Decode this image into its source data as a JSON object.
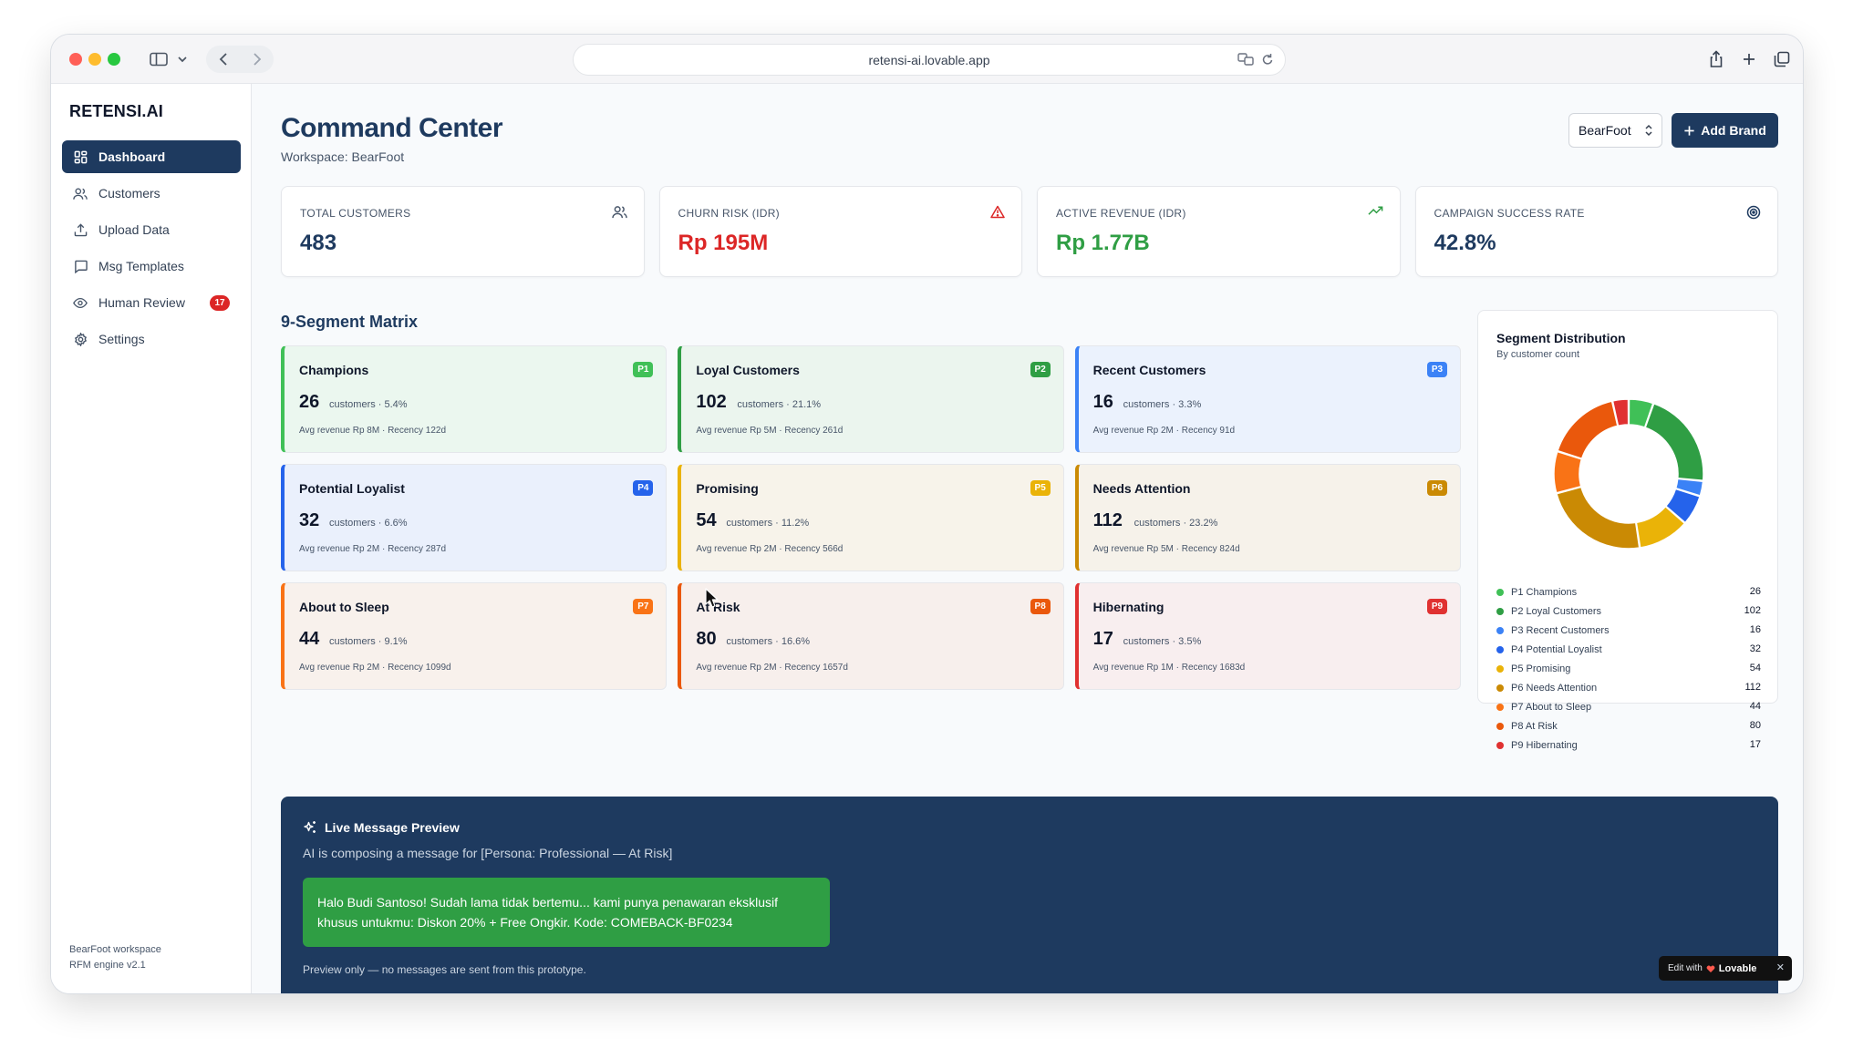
{
  "browser": {
    "url": "retensi-ai.lovable.app"
  },
  "sidebar": {
    "brand": "RETENSI.AI",
    "items": [
      {
        "label": "Dashboard",
        "icon": "grid-icon",
        "active": true
      },
      {
        "label": "Customers",
        "icon": "users-icon"
      },
      {
        "label": "Upload Data",
        "icon": "upload-icon"
      },
      {
        "label": "Msg Templates",
        "icon": "message-icon"
      },
      {
        "label": "Human Review",
        "icon": "eye-icon",
        "badge": "17"
      },
      {
        "label": "Settings",
        "icon": "gear-icon"
      }
    ],
    "footer_line1": "BearFoot workspace",
    "footer_line2": "RFM engine v2.1"
  },
  "header": {
    "title": "Command Center",
    "workspace": "Workspace: BearFoot",
    "brand_select": "BearFoot",
    "add_brand": "Add Brand"
  },
  "kpis": [
    {
      "label": "TOTAL CUSTOMERS",
      "value": "483",
      "icon": "users-icon",
      "color": "#1e3a5f"
    },
    {
      "label": "CHURN RISK (IDR)",
      "value": "Rp 195M",
      "icon": "alert-triangle-icon",
      "color": "#dc2626"
    },
    {
      "label": "ACTIVE REVENUE (IDR)",
      "value": "Rp 1.77B",
      "icon": "trending-up-icon",
      "color": "#2f9e44"
    },
    {
      "label": "CAMPAIGN SUCCESS RATE",
      "value": "42.8%",
      "icon": "target-icon",
      "color": "#1e3a5f"
    }
  ],
  "matrix": {
    "title": "9-Segment Matrix",
    "segments": [
      {
        "name": "Champions",
        "code": "P1",
        "count": "26",
        "sub": "customers · 5.4%",
        "avg": "Avg revenue Rp 8M · Recency 122d",
        "color": "#40c057",
        "bg": "#ebf7ef"
      },
      {
        "name": "Loyal Customers",
        "code": "P2",
        "count": "102",
        "sub": "customers · 21.1%",
        "avg": "Avg revenue Rp 5M · Recency 261d",
        "color": "#2f9e44",
        "bg": "#ebf5ee"
      },
      {
        "name": "Recent Customers",
        "code": "P3",
        "count": "16",
        "sub": "customers · 3.3%",
        "avg": "Avg revenue Rp 2M · Recency 91d",
        "color": "#3b82f6",
        "bg": "#ebf2fd"
      },
      {
        "name": "Potential Loyalist",
        "code": "P4",
        "count": "32",
        "sub": "customers · 6.6%",
        "avg": "Avg revenue Rp 2M · Recency 287d",
        "color": "#2563eb",
        "bg": "#eaf0fc"
      },
      {
        "name": "Promising",
        "code": "P5",
        "count": "54",
        "sub": "customers · 11.2%",
        "avg": "Avg revenue Rp 2M · Recency 566d",
        "color": "#eab308",
        "bg": "#f7f3ea"
      },
      {
        "name": "Needs Attention",
        "code": "P6",
        "count": "112",
        "sub": "customers · 23.2%",
        "avg": "Avg revenue Rp 5M · Recency 824d",
        "color": "#ca8a04",
        "bg": "#f6f2ea"
      },
      {
        "name": "About to Sleep",
        "code": "P7",
        "count": "44",
        "sub": "customers · 9.1%",
        "avg": "Avg revenue Rp 2M · Recency 1099d",
        "color": "#f97316",
        "bg": "#f8f1ec"
      },
      {
        "name": "At Risk",
        "code": "P8",
        "count": "80",
        "sub": "customers · 16.6%",
        "avg": "Avg revenue Rp 2M · Recency 1657d",
        "color": "#ea580c",
        "bg": "#f7efec"
      },
      {
        "name": "Hibernating",
        "code": "P9",
        "count": "17",
        "sub": "customers · 3.5%",
        "avg": "Avg revenue Rp 1M · Recency 1683d",
        "color": "#e03131",
        "bg": "#f8eeef"
      }
    ]
  },
  "distribution": {
    "title": "Segment Distribution",
    "subtitle": "By customer count",
    "legend": [
      {
        "label": "P1 Champions",
        "value": "26",
        "color": "#40c057"
      },
      {
        "label": "P2 Loyal Customers",
        "value": "102",
        "color": "#2f9e44"
      },
      {
        "label": "P3 Recent Customers",
        "value": "16",
        "color": "#3b82f6"
      },
      {
        "label": "P4 Potential Loyalist",
        "value": "32",
        "color": "#2563eb"
      },
      {
        "label": "P5 Promising",
        "value": "54",
        "color": "#eab308"
      },
      {
        "label": "P6 Needs Attention",
        "value": "112",
        "color": "#ca8a04"
      },
      {
        "label": "P7 About to Sleep",
        "value": "44",
        "color": "#f97316"
      },
      {
        "label": "P8 At Risk",
        "value": "80",
        "color": "#ea580c"
      },
      {
        "label": "P9 Hibernating",
        "value": "17",
        "color": "#e03131"
      }
    ]
  },
  "preview": {
    "title": "Live Message Preview",
    "subtitle": "AI is composing a message for [Persona: Professional — At Risk]",
    "message": "Halo Budi Santoso! Sudah lama tidak bertemu... kami punya penawaran eksklusif khusus untukmu: Diskon 20% + Free Ongkir. Kode: COMEBACK-BF0234",
    "note": "Preview only — no messages are sent from this prototype."
  },
  "lovable": {
    "edit_with": "Edit with",
    "brand": "Lovable"
  }
}
